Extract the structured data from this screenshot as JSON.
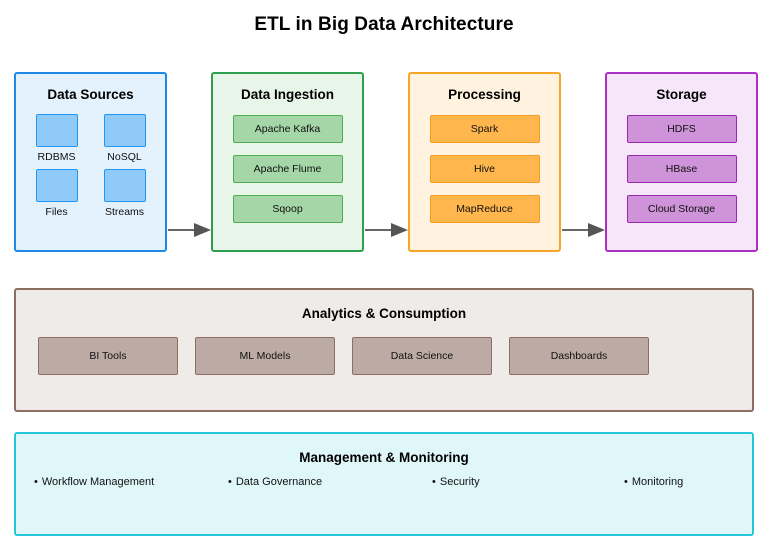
{
  "title": "ETL in Big Data Architecture",
  "colors": {
    "sources_border": "#1e88e5",
    "sources_fill": "#e3f2fd",
    "ingestion_border": "#2e9e4f",
    "ingestion_fill": "#e8f5e9",
    "processing_border": "#f5a623",
    "processing_fill": "#fff3e0",
    "storage_border": "#ab31c6",
    "storage_fill": "#f6e6fa",
    "analytics_border": "#8d6e63",
    "analytics_fill": "#efebe9",
    "management_border": "#26c6da",
    "management_fill": "#e0f7fa",
    "arrow": "#666666"
  },
  "pipeline": {
    "stages": [
      {
        "title": "Data Sources",
        "icons": [
          {
            "label": "RDBMS",
            "icon": "database-icon"
          },
          {
            "label": "NoSQL",
            "icon": "database-icon"
          },
          {
            "label": "Files",
            "icon": "file-icon"
          },
          {
            "label": "Streams",
            "icon": "stream-icon"
          }
        ]
      },
      {
        "title": "Data Ingestion",
        "items": [
          "Apache Kafka",
          "Apache Flume",
          "Sqoop"
        ]
      },
      {
        "title": "Processing",
        "items": [
          "Spark",
          "Hive",
          "MapReduce"
        ]
      },
      {
        "title": "Storage",
        "items": [
          "HDFS",
          "HBase",
          "Cloud Storage"
        ]
      }
    ],
    "arrows": [
      {
        "name": "arrow-sources-to-ingestion"
      },
      {
        "name": "arrow-ingestion-to-processing"
      },
      {
        "name": "arrow-processing-to-storage"
      }
    ]
  },
  "analytics": {
    "title": "Analytics & Consumption",
    "cards": [
      "BI Tools",
      "ML Models",
      "Data Science",
      "Dashboards"
    ]
  },
  "management": {
    "title": "Management & Monitoring",
    "bullet": "•",
    "items": [
      "Workflow Management",
      "Data Governance",
      "Security",
      "Monitoring"
    ]
  }
}
